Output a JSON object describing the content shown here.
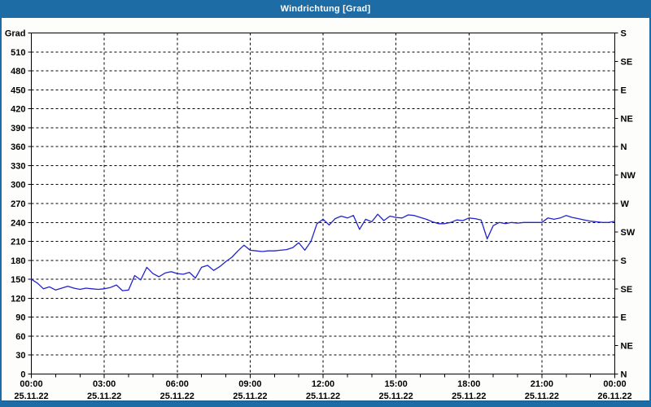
{
  "window": {
    "title": "Windrichtung [Grad]"
  },
  "colors": {
    "titlebar_bg": "#1d6ca5",
    "frame_border": "#1d6ca5",
    "plot_bg": "#ffffff",
    "plot_border": "#000000",
    "grid": "#000000",
    "axis_text": "#000000",
    "line": "#2323cc"
  },
  "chart_data": {
    "type": "line",
    "title": "Windrichtung [Grad]",
    "grid": "dashed",
    "y_axis": {
      "unit": "Grad",
      "min": 0,
      "max": 540,
      "tick_step": 30,
      "labels_top_to_bottom": [
        "Grad",
        "510",
        "480",
        "450",
        "420",
        "390",
        "360",
        "330",
        "300",
        "270",
        "240",
        "210",
        "180",
        "150",
        "120",
        "90",
        "60",
        "30",
        "0"
      ]
    },
    "right_axis": {
      "tick_step_deg": 45,
      "labels_top_to_bottom": [
        "S",
        "SE",
        "E",
        "NE",
        "N",
        "NW",
        "W",
        "SW",
        "S",
        "SE",
        "E",
        "NE",
        "N"
      ]
    },
    "x_axis": {
      "hour_tick_interval": 1,
      "gridline_interval_hours": 3,
      "labels": [
        {
          "time": "00:00",
          "date": "25.11.22"
        },
        {
          "time": "03:00",
          "date": "25.11.22"
        },
        {
          "time": "06:00",
          "date": "25.11.22"
        },
        {
          "time": "09:00",
          "date": "25.11.22"
        },
        {
          "time": "12:00",
          "date": "25.11.22"
        },
        {
          "time": "15:00",
          "date": "25.11.22"
        },
        {
          "time": "18:00",
          "date": "25.11.22"
        },
        {
          "time": "21:00",
          "date": "25.11.22"
        },
        {
          "time": "00:00",
          "date": "26.11.22"
        }
      ]
    },
    "series": [
      {
        "name": "Windrichtung",
        "color": "#2323cc",
        "start": "25.11.22 00:00",
        "interval_minutes": 15,
        "values": [
          150,
          144,
          135,
          138,
          133,
          136,
          139,
          136,
          134,
          136,
          135,
          134,
          135,
          137,
          141,
          132,
          133,
          156,
          149,
          169,
          159,
          154,
          160,
          162,
          159,
          158,
          161,
          152,
          169,
          172,
          164,
          170,
          178,
          185,
          195,
          204,
          196,
          195,
          194,
          195,
          195,
          196,
          197,
          200,
          208,
          196,
          210,
          238,
          245,
          236,
          246,
          250,
          247,
          251,
          229,
          245,
          241,
          253,
          243,
          250,
          248,
          247,
          252,
          251,
          248,
          245,
          241,
          238,
          238,
          240,
          244,
          243,
          247,
          246,
          244,
          214,
          235,
          240,
          238,
          240,
          239,
          240,
          240,
          240,
          240,
          247,
          245,
          247,
          251,
          248,
          246,
          244,
          242,
          241,
          240,
          240,
          242
        ]
      }
    ]
  }
}
